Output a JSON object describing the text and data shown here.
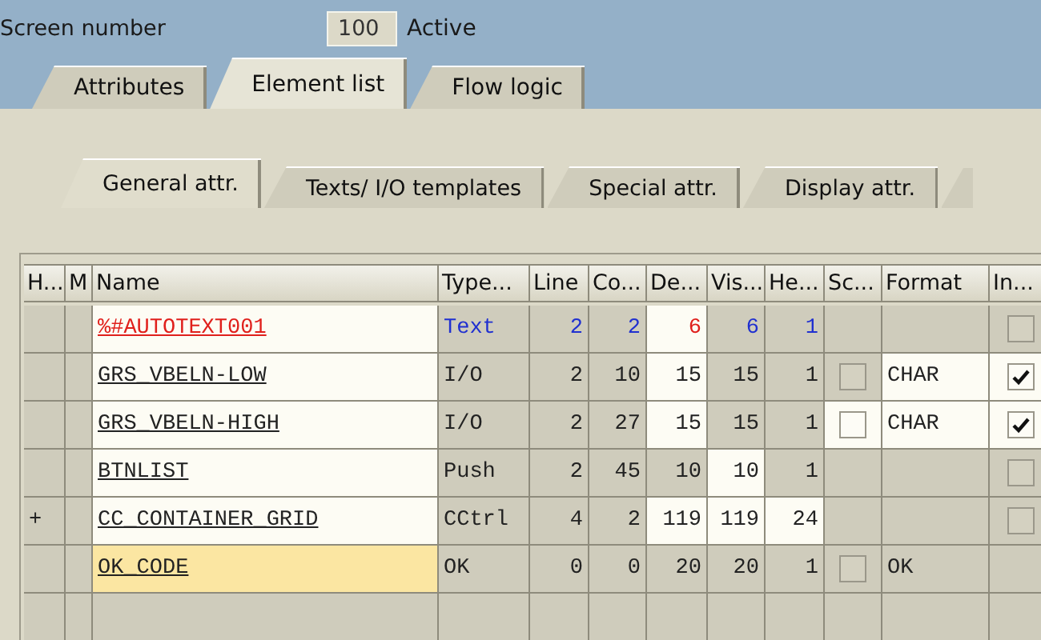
{
  "screen": {
    "label": "Screen number",
    "number": "100",
    "status": "Active"
  },
  "tabs": [
    {
      "label": "Attributes",
      "selected": false
    },
    {
      "label": "Element list",
      "selected": true
    },
    {
      "label": "Flow logic",
      "selected": false
    }
  ],
  "subtabs": [
    {
      "label": "General attr.",
      "selected": true
    },
    {
      "label": "Texts/ I/O templates",
      "selected": false
    },
    {
      "label": "Special attr.",
      "selected": false
    },
    {
      "label": "Display attr.",
      "selected": false
    }
  ],
  "table": {
    "columns": [
      "H...",
      "M",
      "Name",
      "Type...",
      "Line",
      "Co...",
      "De...",
      "Vis...",
      "He...",
      "Sc...",
      "Format",
      "In..."
    ],
    "rows": [
      {
        "kind": "text",
        "selected": false,
        "cells": [
          {
            "kind": "empty",
            "editable": false
          },
          {
            "kind": "empty",
            "editable": false
          },
          {
            "kind": "text",
            "text": "%#AUTOTEXT001",
            "editable": true
          },
          {
            "kind": "text",
            "text": "Text",
            "editable": false
          },
          {
            "kind": "text",
            "text": "2",
            "editable": false
          },
          {
            "kind": "text",
            "text": "2",
            "editable": false
          },
          {
            "kind": "text",
            "text": "6",
            "editable": true
          },
          {
            "kind": "text",
            "text": "6",
            "editable": false
          },
          {
            "kind": "text",
            "text": "1",
            "editable": false
          },
          {
            "kind": "empty",
            "editable": false
          },
          {
            "kind": "empty",
            "editable": false
          },
          {
            "kind": "checkbox",
            "checked": false,
            "editable": false
          }
        ]
      },
      {
        "kind": "field",
        "selected": false,
        "cells": [
          {
            "kind": "empty",
            "editable": false
          },
          {
            "kind": "empty",
            "editable": false
          },
          {
            "kind": "text",
            "text": "GRS_VBELN-LOW",
            "editable": true
          },
          {
            "kind": "text",
            "text": "I/O",
            "editable": false
          },
          {
            "kind": "text",
            "text": "2",
            "editable": false
          },
          {
            "kind": "text",
            "text": "10",
            "editable": false
          },
          {
            "kind": "text",
            "text": "15",
            "editable": true
          },
          {
            "kind": "text",
            "text": "15",
            "editable": false
          },
          {
            "kind": "text",
            "text": "1",
            "editable": false
          },
          {
            "kind": "checkbox",
            "checked": false,
            "editable": false
          },
          {
            "kind": "text",
            "text": "CHAR",
            "editable": true
          },
          {
            "kind": "checkbox",
            "checked": true,
            "editable": true
          }
        ]
      },
      {
        "kind": "field",
        "selected": false,
        "cells": [
          {
            "kind": "empty",
            "editable": false
          },
          {
            "kind": "empty",
            "editable": false
          },
          {
            "kind": "text",
            "text": "GRS_VBELN-HIGH",
            "editable": true
          },
          {
            "kind": "text",
            "text": "I/O",
            "editable": false
          },
          {
            "kind": "text",
            "text": "2",
            "editable": false
          },
          {
            "kind": "text",
            "text": "27",
            "editable": false
          },
          {
            "kind": "text",
            "text": "15",
            "editable": true
          },
          {
            "kind": "text",
            "text": "15",
            "editable": false
          },
          {
            "kind": "text",
            "text": "1",
            "editable": false
          },
          {
            "kind": "checkbox",
            "checked": false,
            "editable": true
          },
          {
            "kind": "text",
            "text": "CHAR",
            "editable": true
          },
          {
            "kind": "checkbox",
            "checked": true,
            "editable": true
          }
        ]
      },
      {
        "kind": "field",
        "selected": false,
        "cells": [
          {
            "kind": "empty",
            "editable": false
          },
          {
            "kind": "empty",
            "editable": false
          },
          {
            "kind": "text",
            "text": "BTNLIST",
            "editable": true
          },
          {
            "kind": "text",
            "text": "Push",
            "editable": false
          },
          {
            "kind": "text",
            "text": "2",
            "editable": false
          },
          {
            "kind": "text",
            "text": "45",
            "editable": false
          },
          {
            "kind": "text",
            "text": "10",
            "editable": false
          },
          {
            "kind": "text",
            "text": "10",
            "editable": true
          },
          {
            "kind": "text",
            "text": "1",
            "editable": false
          },
          {
            "kind": "empty",
            "editable": false
          },
          {
            "kind": "empty",
            "editable": false
          },
          {
            "kind": "checkbox",
            "checked": false,
            "editable": false
          }
        ]
      },
      {
        "kind": "field",
        "selected": false,
        "cells": [
          {
            "kind": "text",
            "text": "+",
            "editable": false
          },
          {
            "kind": "empty",
            "editable": false
          },
          {
            "kind": "text",
            "text": "CC_CONTAINER_GRID",
            "editable": true
          },
          {
            "kind": "text",
            "text": "CCtrl",
            "editable": false
          },
          {
            "kind": "text",
            "text": "4",
            "editable": false
          },
          {
            "kind": "text",
            "text": "2",
            "editable": false
          },
          {
            "kind": "text",
            "text": "119",
            "editable": true
          },
          {
            "kind": "text",
            "text": "119",
            "editable": true
          },
          {
            "kind": "text",
            "text": "24",
            "editable": true
          },
          {
            "kind": "empty",
            "editable": false
          },
          {
            "kind": "empty",
            "editable": false
          },
          {
            "kind": "checkbox",
            "checked": false,
            "editable": false
          }
        ]
      },
      {
        "kind": "field",
        "selected": true,
        "cells": [
          {
            "kind": "empty",
            "editable": false
          },
          {
            "kind": "empty",
            "editable": false
          },
          {
            "kind": "text",
            "text": "OK_CODE",
            "editable": true
          },
          {
            "kind": "text",
            "text": "OK",
            "editable": false
          },
          {
            "kind": "text",
            "text": "0",
            "editable": false
          },
          {
            "kind": "text",
            "text": "0",
            "editable": false
          },
          {
            "kind": "text",
            "text": "20",
            "editable": false
          },
          {
            "kind": "text",
            "text": "20",
            "editable": false
          },
          {
            "kind": "text",
            "text": "1",
            "editable": false
          },
          {
            "kind": "checkbox",
            "checked": false,
            "editable": false
          },
          {
            "kind": "text",
            "text": "OK",
            "editable": false
          },
          {
            "kind": "empty",
            "editable": false
          }
        ]
      }
    ]
  }
}
